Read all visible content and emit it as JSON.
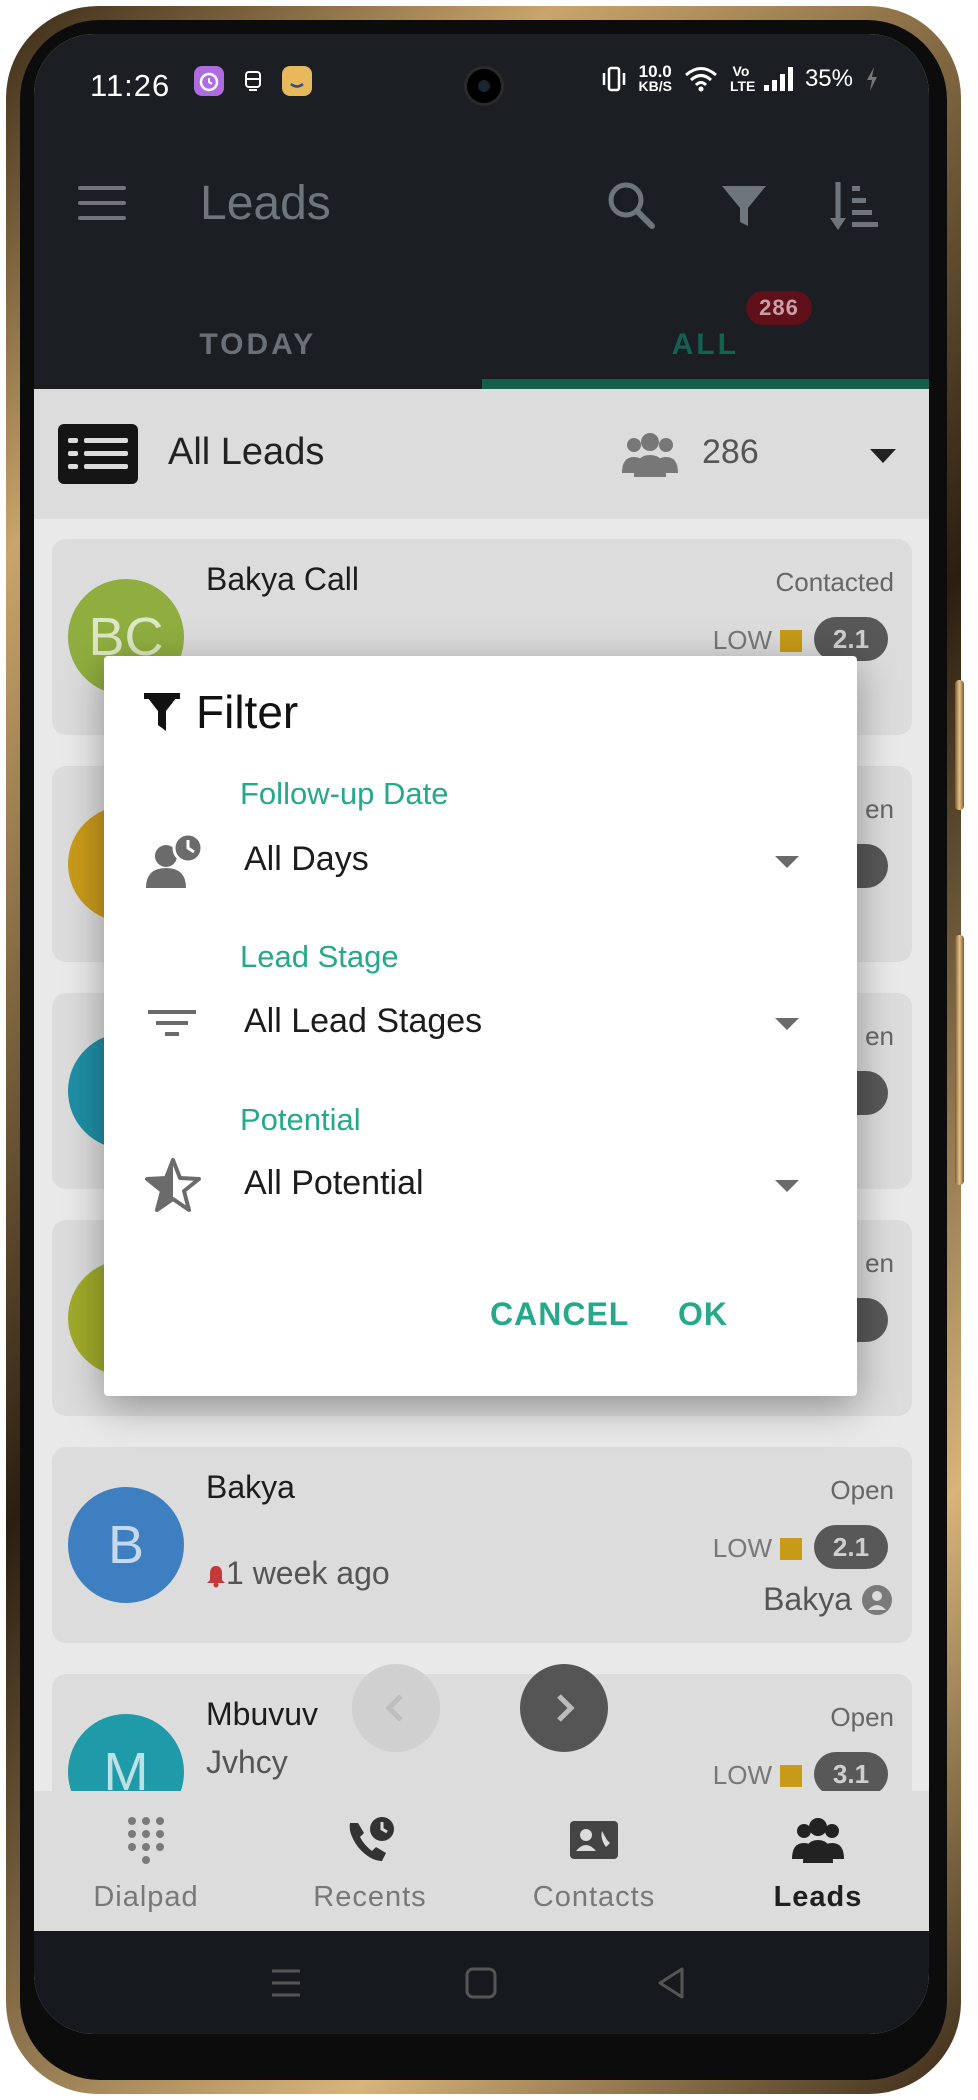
{
  "status_bar": {
    "time": "11:26",
    "net_speed_value": "10.0",
    "net_speed_unit": "KB/S",
    "volte": "Vo LTE",
    "battery": "35%"
  },
  "app_bar": {
    "title": "Leads",
    "icons": [
      "menu-icon",
      "search-icon",
      "filter-icon",
      "sort-icon"
    ]
  },
  "tabs": [
    {
      "label": "TODAY",
      "active": false
    },
    {
      "label": "ALL",
      "active": true,
      "badge": "286"
    }
  ],
  "list_header": {
    "title": "All Leads",
    "count": "286"
  },
  "leads": [
    {
      "initials": "BC",
      "name": "Bakya Call",
      "status": "Contacted",
      "level": "LOW",
      "score": "2.1",
      "sub": "",
      "owner": "",
      "color": "#8fae3f"
    },
    {
      "initials": "",
      "name": "",
      "status": "en",
      "level": "",
      "score": "",
      "sub": "",
      "owner": "",
      "color": "#c99a1b"
    },
    {
      "initials": "",
      "name": "",
      "status": "en",
      "level": "",
      "score": "",
      "sub": "",
      "owner": "",
      "color": "#1f8fa5"
    },
    {
      "initials": "",
      "name": "",
      "status": "en",
      "level": "",
      "score": "",
      "sub": "",
      "owner": "",
      "color": "#a0ab2a"
    },
    {
      "initials": "B",
      "name": "Bakya",
      "status": "Open",
      "level": "LOW",
      "score": "2.1",
      "sub": "1 week ago",
      "owner": "Bakya",
      "color": "#3d7fc0"
    },
    {
      "initials": "M",
      "name": "Mbuvuv",
      "status": "Open",
      "level": "LOW",
      "score": "3.1",
      "sub": "Jvhcy",
      "owner": "",
      "color": "#1f9aa8"
    }
  ],
  "bottom_nav": [
    {
      "label": "Dialpad",
      "icon": "dialpad-icon",
      "active": false
    },
    {
      "label": "Recents",
      "icon": "recents-icon",
      "active": false
    },
    {
      "label": "Contacts",
      "icon": "contacts-icon",
      "active": false
    },
    {
      "label": "Leads",
      "icon": "leads-icon",
      "active": true
    }
  ],
  "filter_dialog": {
    "title": "Filter",
    "fields": [
      {
        "label": "Follow-up Date",
        "value": "All Days",
        "icon": "follow-up-clock-icon"
      },
      {
        "label": "Lead Stage",
        "value": "All Lead Stages",
        "icon": "lead-stage-icon"
      },
      {
        "label": "Potential",
        "value": "All Potential",
        "icon": "potential-star-icon"
      }
    ],
    "cancel_label": "CANCEL",
    "ok_label": "OK"
  },
  "colors": {
    "accent": "#26a88a",
    "app_bar": "#1b1f24",
    "tab_indicator": "#155e4c",
    "badge": "#5f1019"
  }
}
